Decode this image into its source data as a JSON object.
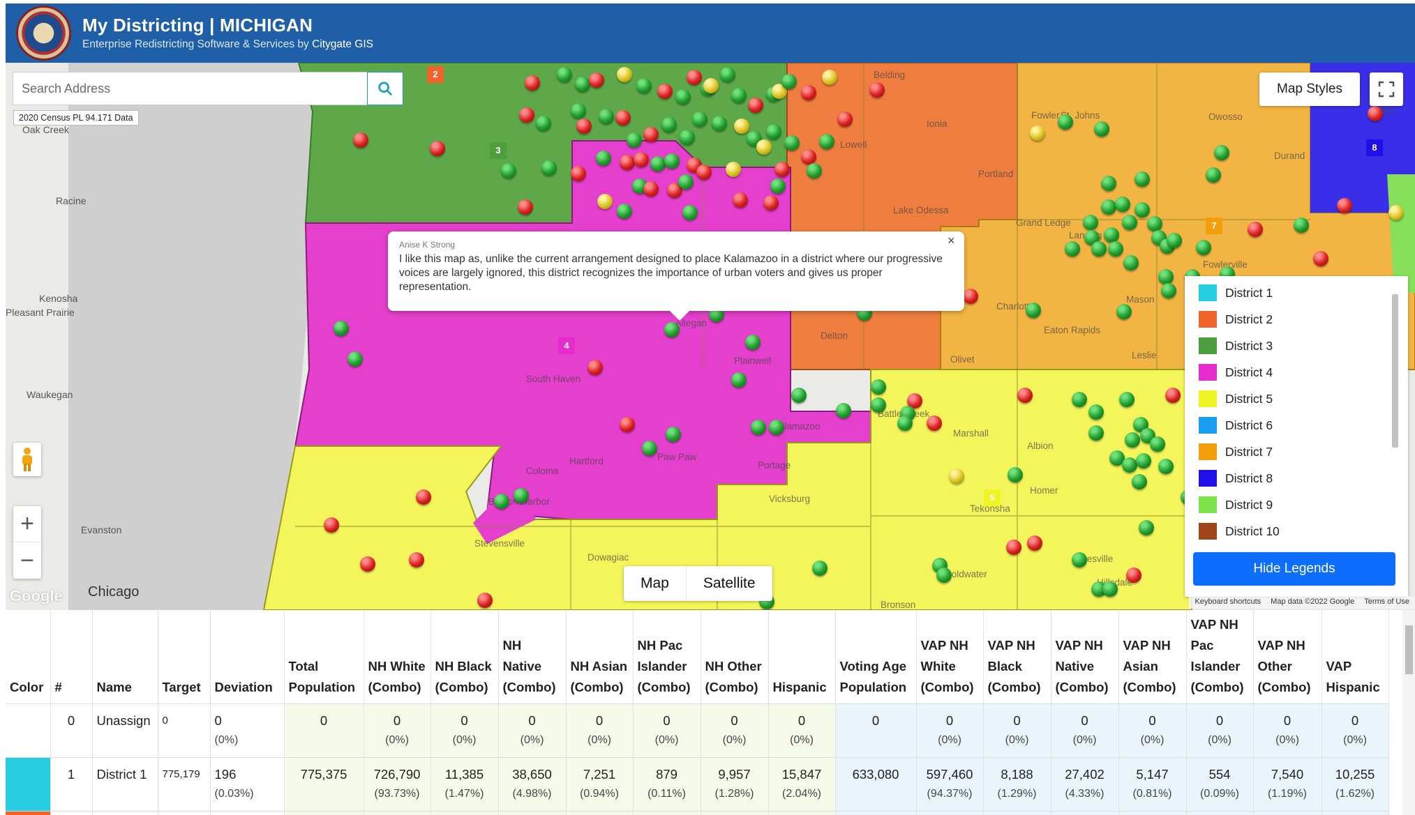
{
  "header": {
    "title": "My Districting | MICHIGAN",
    "subtitle": "Enterprise Redistricting Software & Services by",
    "company": "Citygate GIS"
  },
  "map": {
    "search_placeholder": "Search Address",
    "census_label": "2020 Census PL 94.171 Data",
    "map_styles_label": "Map Styles",
    "map_type": [
      "Map",
      "Satellite"
    ],
    "google_logo": "Google",
    "attribution": [
      "Keyboard shortcuts",
      "Map data ©2022 Google",
      "Terms of Use"
    ],
    "district_numbers": [
      "2",
      "3",
      "4",
      "5",
      "7",
      "8"
    ],
    "places": [
      "Oak Creek",
      "Racine",
      "Kenosha",
      "Pleasant Prairie",
      "Waukegan",
      "Evanston",
      "Chicago",
      "Belding",
      "Ionia",
      "Lowell",
      "Portland",
      "Lake Odessa",
      "Grand Ledge",
      "Lansing",
      "St. Johns",
      "Owosso",
      "Durand",
      "Flint",
      "Fowler",
      "Fowlerville",
      "Charlotte",
      "Eaton Rapids",
      "Mason",
      "Leslie",
      "Olivet",
      "Delton",
      "Plainwell",
      "Allegan",
      "South Haven",
      "Marshall",
      "Albion",
      "Battle Creek",
      "Kalamazoo",
      "Portage",
      "Paw Paw",
      "Hartford",
      "Coloma",
      "Benton Harbor",
      "Stevensville",
      "Dowagiac",
      "Vicksburg",
      "Tekonsha",
      "Homer",
      "Coldwater",
      "Jonesville",
      "Hillsdale",
      "Bronson"
    ],
    "popup": {
      "author": "Anise K Strong",
      "text": "I like this map as, unlike the current arrangement designed to place Kalamazoo in a district where our progressive voices are largely ignored, this district recognizes the importance of urban voters and gives us proper representation.",
      "close": "×"
    },
    "legend": {
      "items": [
        {
          "label": "District 1",
          "color": "#26cde0"
        },
        {
          "label": "District 2",
          "color": "#f0632a"
        },
        {
          "label": "District 3",
          "color": "#4e9e3f"
        },
        {
          "label": "District 4",
          "color": "#e62bcf"
        },
        {
          "label": "District 5",
          "color": "#eef522"
        },
        {
          "label": "District 6",
          "color": "#1a9eef"
        },
        {
          "label": "District 7",
          "color": "#f59e0b"
        },
        {
          "label": "District 8",
          "color": "#1f10e8"
        },
        {
          "label": "District 9",
          "color": "#7ee24a"
        },
        {
          "label": "District 10",
          "color": "#a0461a"
        }
      ],
      "hide_button": "Hide Legends"
    }
  },
  "table": {
    "headers": [
      "Color",
      "#",
      "Name",
      "Target",
      "Deviation",
      "Total Population",
      "NH White (Combo)",
      "NH Black (Combo)",
      "NH Native (Combo)",
      "NH Asian (Combo)",
      "NH Pac Islander (Combo)",
      "NH Other (Combo)",
      "Hispanic",
      "Voting Age Population",
      "VAP NH White (Combo)",
      "VAP NH Black (Combo)",
      "VAP NH Native (Combo)",
      "VAP NH Asian (Combo)",
      "VAP NH Pac Islander (Combo)",
      "VAP NH Other (Combo)",
      "VAP Hispanic"
    ],
    "rows": [
      {
        "color": "",
        "num": "0",
        "name": "Unassign",
        "target": "0",
        "deviation": "0",
        "deviation_pct": "(0%)",
        "total": "0",
        "cells": [
          [
            "0",
            "(0%)"
          ],
          [
            "0",
            "(0%)"
          ],
          [
            "0",
            "(0%)"
          ],
          [
            "0",
            "(0%)"
          ],
          [
            "0",
            "(0%)"
          ],
          [
            "0",
            "(0%)"
          ],
          [
            "0",
            "(0%)"
          ]
        ],
        "vap": "0",
        "vap_cells": [
          [
            "0",
            "(0%)"
          ],
          [
            "0",
            "(0%)"
          ],
          [
            "0",
            "(0%)"
          ],
          [
            "0",
            "(0%)"
          ],
          [
            "0",
            "(0%)"
          ],
          [
            "0",
            "(0%)"
          ],
          [
            "0",
            "(0%)"
          ]
        ]
      },
      {
        "color": "#26cde0",
        "num": "1",
        "name": "District 1",
        "target": "775,179",
        "deviation": "196",
        "deviation_pct": "(0.03%)",
        "total": "775,375",
        "cells": [
          [
            "726,790",
            "(93.73%)"
          ],
          [
            "11,385",
            "(1.47%)"
          ],
          [
            "38,650",
            "(4.98%)"
          ],
          [
            "7,251",
            "(0.94%)"
          ],
          [
            "879",
            "(0.11%)"
          ],
          [
            "9,957",
            "(1.28%)"
          ],
          [
            "15,847",
            "(2.04%)"
          ]
        ],
        "vap": "633,080",
        "vap_cells": [
          [
            "597,460",
            "(94.37%)"
          ],
          [
            "8,188",
            "(1.29%)"
          ],
          [
            "27,402",
            "(4.33%)"
          ],
          [
            "5,147",
            "(0.81%)"
          ],
          [
            "554",
            "(0.09%)"
          ],
          [
            "7,540",
            "(1.19%)"
          ],
          [
            "10,255",
            "(1.62%)"
          ]
        ]
      },
      {
        "color": "#f0632a",
        "num": "",
        "name": "",
        "target": "",
        "deviation": "",
        "deviation_pct": "",
        "total": "",
        "cells": [
          [
            "",
            ""
          ],
          [
            "",
            ""
          ],
          [
            "",
            ""
          ],
          [
            "",
            ""
          ],
          [
            "",
            ""
          ],
          [
            "",
            ""
          ],
          [
            "",
            ""
          ]
        ],
        "vap": "",
        "vap_cells": [
          [
            "",
            ""
          ],
          [
            "",
            ""
          ],
          [
            "",
            ""
          ],
          [
            "",
            ""
          ],
          [
            "",
            ""
          ],
          [
            "",
            ""
          ],
          [
            "",
            ""
          ]
        ]
      }
    ]
  }
}
